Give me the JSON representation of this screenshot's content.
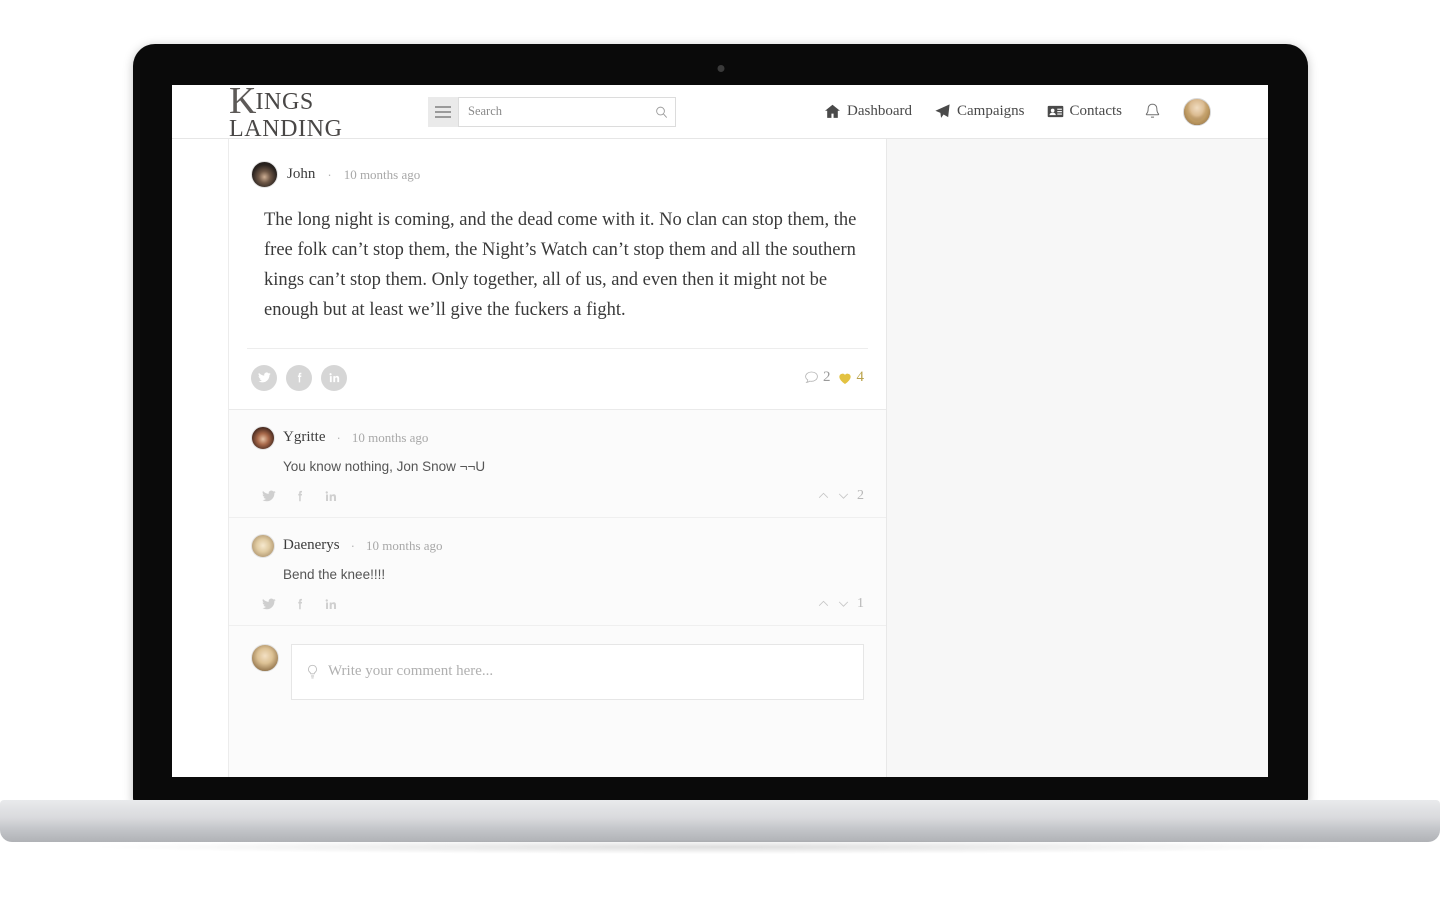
{
  "brand": {
    "logo_initial": "K",
    "logo_rest": "INGS LANDING",
    "accent_color": "#8d3b3b"
  },
  "search": {
    "placeholder": "Search",
    "value": "",
    "menu_icon": "hamburger-menu-icon",
    "icon": "search-icon"
  },
  "nav": {
    "items": [
      {
        "label": "Dashboard",
        "icon": "home-icon"
      },
      {
        "label": "Campaigns",
        "icon": "paper-plane-icon"
      },
      {
        "label": "Contacts",
        "icon": "contact-card-icon"
      }
    ],
    "bell_icon": "notification-bell-icon",
    "avatar": "user-avatar"
  },
  "post": {
    "author": "John",
    "separator": "·",
    "timestamp": "10 months ago",
    "body": "The long night is coming, and the dead come with it. No clan can stop them, the free folk can’t stop them, the Night’s Watch can’t stop them and all the southern kings can’t stop them. Only together, all of us, and even then it might not be enough but at least we’ll give the fuckers a fight.",
    "share": [
      {
        "name": "twitter-share-button",
        "icon": "twitter-icon"
      },
      {
        "name": "facebook-share-button",
        "icon": "facebook-icon"
      },
      {
        "name": "linkedin-share-button",
        "icon": "linkedin-icon"
      }
    ],
    "comment_count": "2",
    "like_count": "4",
    "like_color": "#e3c241"
  },
  "comments": [
    {
      "author": "Ygritte",
      "separator": "·",
      "timestamp": "10 months ago",
      "text": "You know nothing, Jon Snow ¬¬U",
      "vote_count": "2"
    },
    {
      "author": "Daenerys",
      "separator": "·",
      "timestamp": "10 months ago",
      "text": "Bend the knee!!!!",
      "vote_count": "1"
    }
  ],
  "composer": {
    "placeholder": "Write your comment here...",
    "value": "",
    "icon": "lightbulb-icon"
  }
}
